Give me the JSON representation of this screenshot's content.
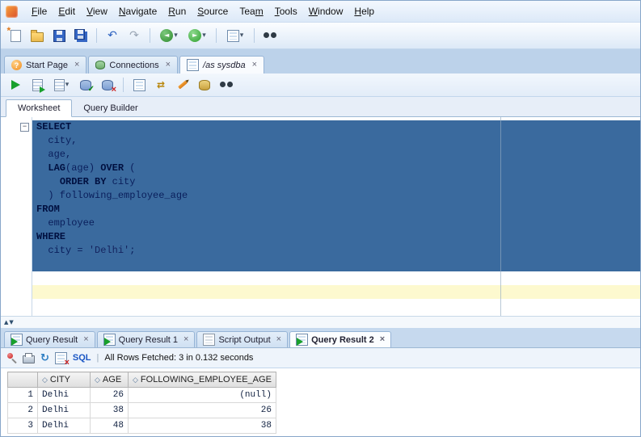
{
  "app": {
    "menu": [
      {
        "label": "File",
        "key": 0
      },
      {
        "label": "Edit",
        "key": 0
      },
      {
        "label": "View",
        "key": 0
      },
      {
        "label": "Navigate",
        "key": 0
      },
      {
        "label": "Run",
        "key": 0
      },
      {
        "label": "Source",
        "key": 0
      },
      {
        "label": "Team",
        "key": 3
      },
      {
        "label": "Tools",
        "key": 0
      },
      {
        "label": "Window",
        "key": 0
      },
      {
        "label": "Help",
        "key": 0
      }
    ]
  },
  "colors": {
    "selection": "#3a6a9e",
    "current_line": "#fdf9cf",
    "keyword": "#001040",
    "accent_blue": "#1a56c4"
  },
  "main_toolbar_icons": [
    "new-file-icon",
    "open-folder-icon",
    "save-icon",
    "save-all-icon",
    "undo-icon",
    "redo-icon",
    "back-icon",
    "forward-icon",
    "new-worksheet-icon",
    "find-icon"
  ],
  "doc_tabs": [
    {
      "label": "Start Page",
      "icon": "help-icon"
    },
    {
      "label": "Connections",
      "icon": "connections-icon"
    },
    {
      "label": "/as sysdba",
      "icon": "worksheet-icon"
    }
  ],
  "worksheet_toolbar_icons": [
    "run-statement-icon",
    "run-script-icon",
    "explain-plan-icon",
    "autotrace-icon",
    "commit-icon",
    "rollback-icon",
    "unshared-worksheet-icon",
    "clear-icon",
    "sql-history-icon",
    "find-db-icon"
  ],
  "editor_tabs": [
    {
      "label": "Worksheet"
    },
    {
      "label": "Query Builder"
    }
  ],
  "editor": {
    "lines": [
      [
        {
          "t": "SELECT",
          "k": 1
        }
      ],
      [
        {
          "t": "  city,"
        }
      ],
      [
        {
          "t": "  age,"
        }
      ],
      [
        {
          "t": "  "
        },
        {
          "t": "LAG",
          "k": 1
        },
        {
          "t": "(age) "
        },
        {
          "t": "OVER",
          "k": 1
        },
        {
          "t": " ("
        }
      ],
      [
        {
          "t": "    "
        },
        {
          "t": "ORDER BY",
          "k": 1
        },
        {
          "t": " city"
        }
      ],
      [
        {
          "t": "  ) following_employee_age"
        }
      ],
      [
        {
          "t": "FROM",
          "k": 1
        }
      ],
      [
        {
          "t": "  employee"
        }
      ],
      [
        {
          "t": "WHERE",
          "k": 1
        }
      ],
      [
        {
          "t": "  city = "
        },
        {
          "t": "'Delhi'",
          "s": 1
        },
        {
          "t": ";"
        }
      ]
    ]
  },
  "result_tabs": [
    {
      "label": "Query Result",
      "icon": "query-result-icon"
    },
    {
      "label": "Query Result 1",
      "icon": "query-result-icon"
    },
    {
      "label": "Script Output",
      "icon": "script-output-icon"
    },
    {
      "label": "Query Result 2",
      "icon": "query-result-icon"
    }
  ],
  "results_toolbar": {
    "icons": [
      "pin-icon",
      "print-icon",
      "refresh-icon",
      "clear-results-icon"
    ],
    "sql_label": "SQL",
    "status": "All Rows Fetched: 3 in 0.132 seconds"
  },
  "grid": {
    "columns": [
      "CITY",
      "AGE",
      "FOLLOWING_EMPLOYEE_AGE"
    ],
    "rows": [
      {
        "num": "1",
        "city": "Delhi",
        "age": "26",
        "following": "(null)"
      },
      {
        "num": "2",
        "city": "Delhi",
        "age": "38",
        "following": "26"
      },
      {
        "num": "3",
        "city": "Delhi",
        "age": "48",
        "following": "38"
      }
    ]
  }
}
